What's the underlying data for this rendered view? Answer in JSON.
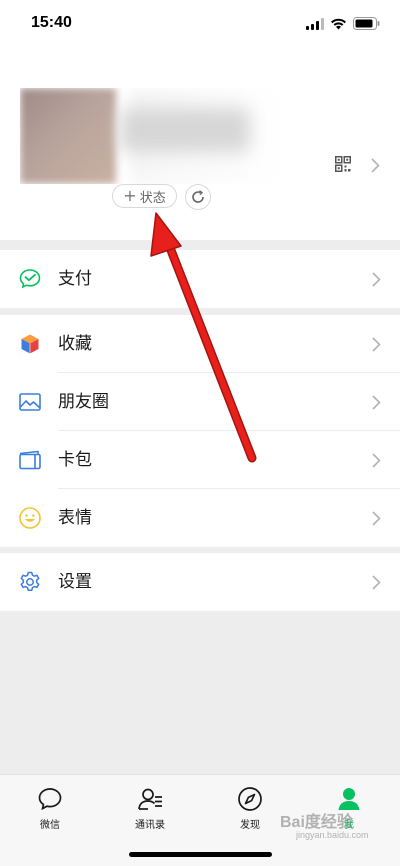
{
  "status_bar": {
    "time": "15:40",
    "signal_icon": "signal-icon",
    "wifi_icon": "wifi-icon",
    "battery_icon": "battery-icon"
  },
  "profile": {
    "status_button_label": "状态",
    "qr_icon": "qr-code-icon",
    "refresh_icon": "refresh-icon"
  },
  "menu": {
    "pay": {
      "label": "支付",
      "icon": "pay-icon",
      "color": "#07c160"
    },
    "favorites": {
      "label": "收藏",
      "icon": "cube-icon"
    },
    "moments": {
      "label": "朋友圈",
      "icon": "picture-icon",
      "color": "#3b7de0"
    },
    "cards": {
      "label": "卡包",
      "icon": "wallet-icon",
      "color": "#3b7de0"
    },
    "stickers": {
      "label": "表情",
      "icon": "smile-icon",
      "color": "#f2c431"
    },
    "settings": {
      "label": "设置",
      "icon": "gear-icon",
      "color": "#3b7de0"
    }
  },
  "tabbar": {
    "tabs": [
      {
        "label": "微信",
        "icon": "chat-icon"
      },
      {
        "label": "通讯录",
        "icon": "contacts-icon"
      },
      {
        "label": "发现",
        "icon": "compass-icon"
      },
      {
        "label": "我",
        "icon": "person-icon",
        "active": true
      }
    ]
  },
  "watermark": {
    "text": "Bai度经验",
    "sub": "jingyan.baidu.com"
  },
  "colors": {
    "accent": "#07c160",
    "annotation_arrow": "#e8201b"
  }
}
